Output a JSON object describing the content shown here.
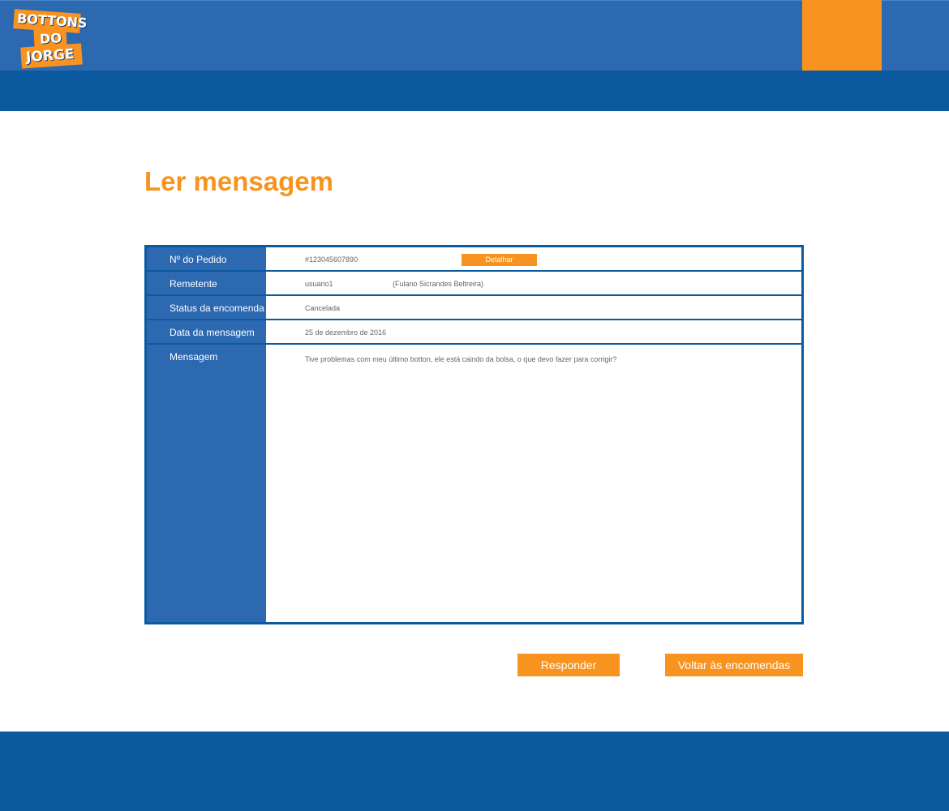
{
  "header": {
    "logo": {
      "line1": "BOTTONS",
      "line2": "DO",
      "line3": "JORGE"
    },
    "colors": {
      "primary": "#2d69b1",
      "dark": "#0b5aa0",
      "accent": "#f7931e"
    }
  },
  "page_title": "Ler mensagem",
  "message": {
    "rows": [
      {
        "label": "Nº do Pedido",
        "value": "#123045607890",
        "action_label": "Detalhar"
      },
      {
        "label": "Remetente",
        "value": "usuario1",
        "secondary": "(Fulano Sicrandes Beltreira)"
      },
      {
        "label": "Status da encomenda",
        "value": "Cancelada"
      },
      {
        "label": "Data da mensagem",
        "value": "25 de dezembro de 2016"
      },
      {
        "label": "Mensagem",
        "value": "Tive problemas com meu último botton, ele está caindo da bolsa, o que devo fazer para corrigir?"
      }
    ]
  },
  "actions": {
    "reply_label": "Responder",
    "back_label": "Voltar às encomendas"
  }
}
